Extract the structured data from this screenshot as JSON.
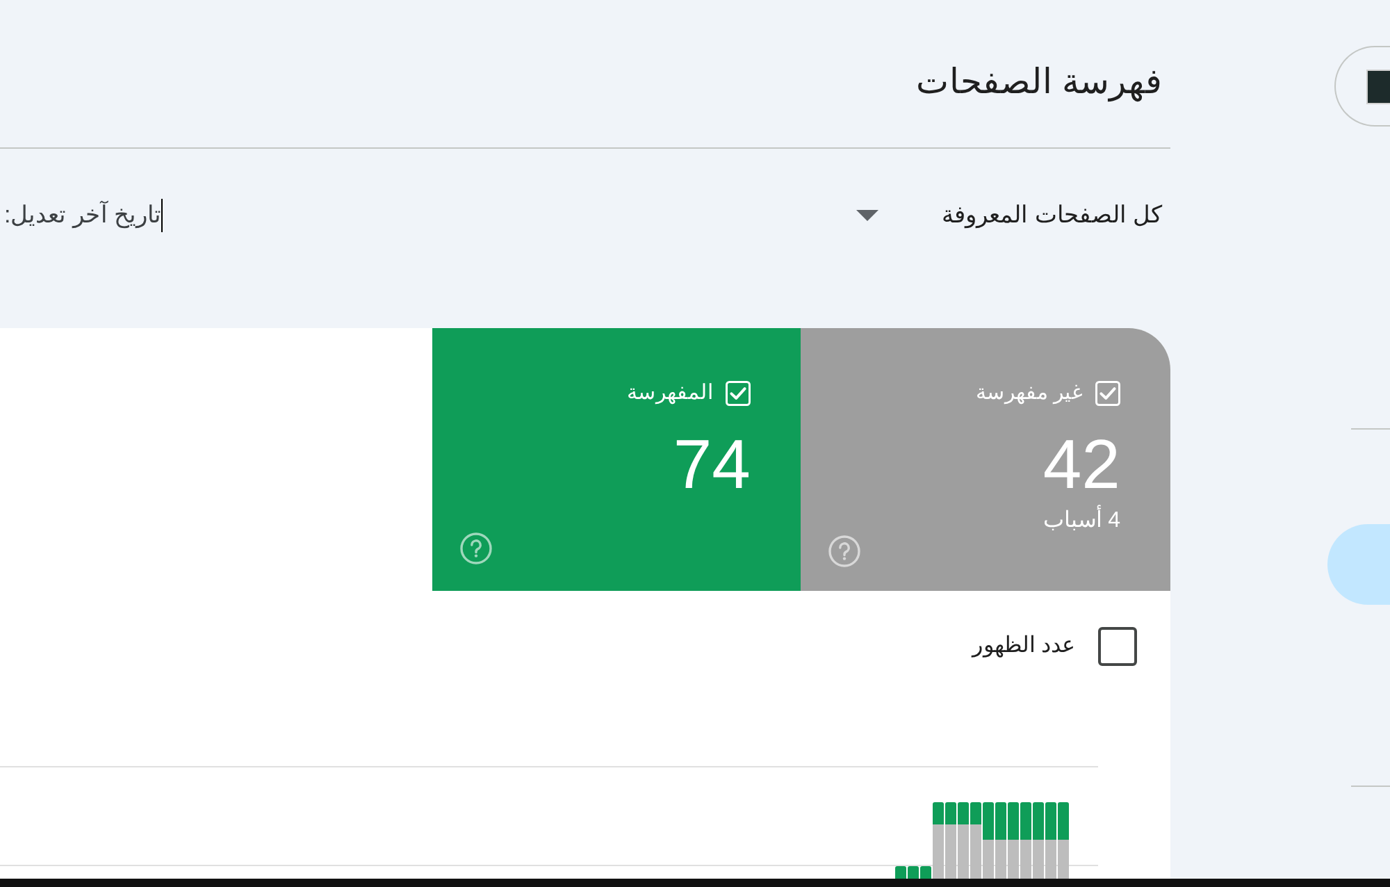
{
  "sidebar": {
    "nav_items": [
      {
        "selected": true
      }
    ]
  },
  "page": {
    "title": "فهرسة الصفحات"
  },
  "filters": {
    "pages_dropdown": {
      "value": "كل الصفحات المعروفة"
    },
    "last_modified": {
      "label": "تاريخ آخر تعديل:"
    }
  },
  "summary_tiles": [
    {
      "label": "غير مفهرسة",
      "checked": true,
      "count": "42",
      "subtitle": "4 أسباب",
      "color": "#9e9e9e"
    },
    {
      "label": "المفهرسة",
      "checked": true,
      "count": "74",
      "color": "#0f9d58"
    }
  ],
  "impressions_toggle": {
    "label": "عدد الظهور",
    "checked": false
  }
}
